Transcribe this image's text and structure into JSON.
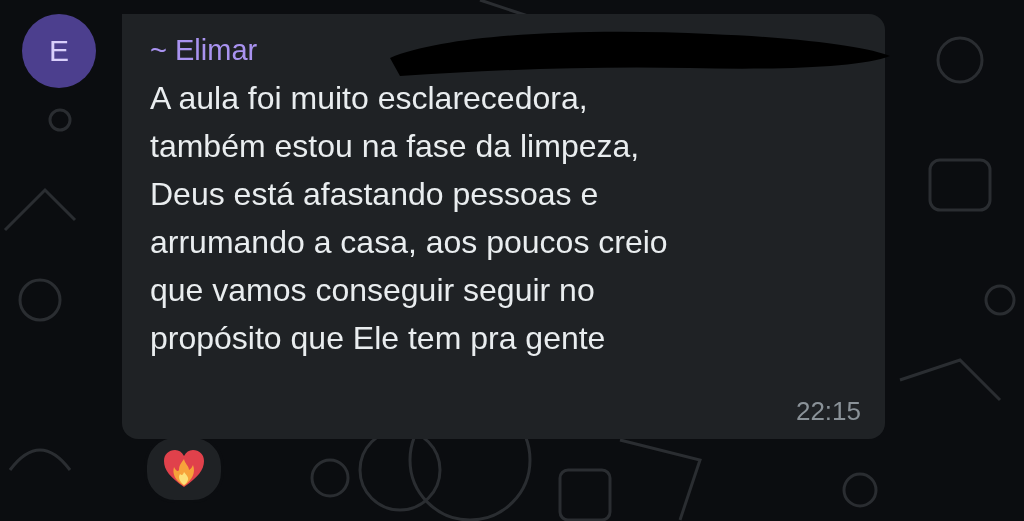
{
  "message": {
    "avatar_initial": "E",
    "sender": "~ Elimar",
    "text": "A aula foi muito esclarecedora,\ntambém estou na fase da limpeza,\nDeus está afastando pessoas e\narrumando a casa, aos poucos creio\nque vamos conseguir seguir no\npropósito que Ele tem pra gente",
    "time": "22:15"
  }
}
